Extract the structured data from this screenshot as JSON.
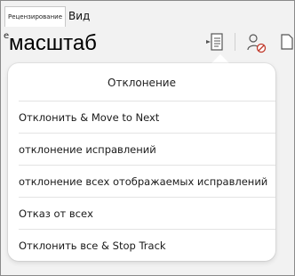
{
  "ribbon": {
    "tabs": [
      {
        "label": "Рецензирование"
      },
      {
        "label": "Вид"
      }
    ]
  },
  "toolbar": {
    "cut_letter": "е",
    "zoom_label": "масштаб",
    "icons": [
      "accept-document-icon",
      "reject-user-icon",
      "document-icon"
    ]
  },
  "reject_menu": {
    "header": "Отклонение",
    "items": [
      {
        "label": "Отклонить & Move to Next"
      },
      {
        "label": "отклонение исправлений"
      },
      {
        "label": "отклонение всех отображаемых исправлений"
      },
      {
        "label": "Отказ от всех"
      },
      {
        "label": "Отклонить все & Stop Track"
      }
    ]
  }
}
